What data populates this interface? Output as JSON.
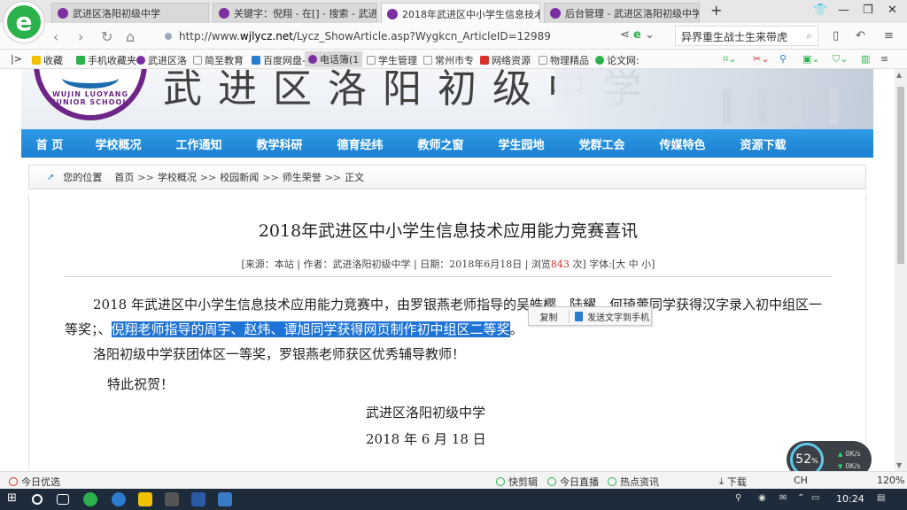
{
  "browser": {
    "tabs": [
      {
        "title": "武进区洛阳初级中学",
        "active": false
      },
      {
        "title": "关键字：倪翔 - 在[] - 搜索 - 武进区",
        "active": false
      },
      {
        "title": "2018年武进区中小学生信息技术...",
        "active": true
      },
      {
        "title": "后台管理 - 武进区洛阳初级中学",
        "active": false
      }
    ],
    "new_tab": "+",
    "url_prefix": "http://www.",
    "url_domain": "wjlycz.net",
    "url_path": "/Lycz_ShowArticle.asp?Wygkcn_ArticleID=12989",
    "search_text": "异界重生战士生来带虎",
    "bookmarks": [
      "收藏",
      "手机收藏夹",
      "武进区洛",
      "简至教育",
      "百度网盘-",
      "电话簿(1",
      "学生管理",
      "常州市专",
      "网络资源",
      "物理精品",
      "论文网:"
    ]
  },
  "site": {
    "banner_text": "武进区洛阳初级中学",
    "seal_text": "WUJIN LUOYANG JUNIOR SCHOOL",
    "nav": [
      "首 页",
      "学校概况",
      "工作通知",
      "教学科研",
      "德育经纬",
      "教师之窗",
      "学生园地",
      "党群工会",
      "传媒特色",
      "资源下载"
    ],
    "breadcrumb": {
      "prefix": "您的位置",
      "items": [
        "首页",
        "学校概况",
        "校园新闻",
        "师生荣誉",
        "正文"
      ],
      "sep": ">>"
    }
  },
  "article": {
    "title": "2018年武进区中小学生信息技术应用能力竞赛喜讯",
    "meta_source": "[来源：本站 | 作者：武进洛阳初级中学 | 日期：2018年6月18日 | 浏览",
    "views": "843",
    "meta_tail": " 次] 字体:[大 中 小]",
    "para1_line1": "2018 年武进区中小学生信息技术应用能力竞赛中，由罗银燕老师指导的吴皓樱、陆耀、何琦蕾同学获得汉字录入初中组区一",
    "para1_line2_pre": "等奖；、",
    "para1_line2_hl": "倪翔老师指导的周宇、赵炜、谭旭同学获得网页制作初中组区二等奖",
    "para1_line2_post": "。",
    "para2": "洛阳初级中学获团体区一等奖，罗银燕老师获区优秀辅导教师！",
    "para3": "特此祝贺！",
    "sign_org": "武进区洛阳初级中学",
    "sign_date": "2018 年 6 月 18 日"
  },
  "context_menu": {
    "copy": "复制",
    "send": "发送文字到手机"
  },
  "status": {
    "left": "今日优选",
    "items": [
      "快剪辑",
      "今日直播",
      "热点资讯",
      "下载"
    ],
    "zoom": "120%",
    "ime": "CH"
  },
  "speed": {
    "percent": "52",
    "unit": "%",
    "up": "0K/s",
    "down": "0K/s"
  },
  "taskbar": {
    "time": "10:24"
  }
}
